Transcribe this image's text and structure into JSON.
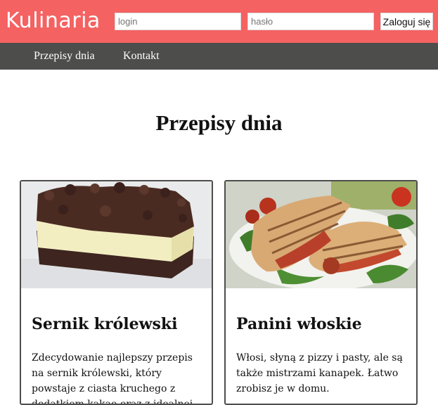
{
  "header": {
    "logo": "Kulinaria",
    "login_placeholder": "login",
    "password_placeholder": "hasło",
    "login_button": "Zaloguj się"
  },
  "nav": {
    "items": [
      "Przepisy dnia",
      "Kontakt"
    ]
  },
  "main": {
    "title": "Przepisy dnia",
    "recipes": [
      {
        "title": "Sernik królewski",
        "description": "Zdecydowanie najlepszy przepis na sernik królewski, który powstaje z ciasta kruchego z dodatkiem kakao oraz z idealnej"
      },
      {
        "title": "Panini włoskie",
        "description": "Włosi, słyną z pizzy i pasty, ale są także mistrzami kanapek. Łatwo zrobisz je w domu."
      }
    ]
  },
  "colors": {
    "header_bg": "#f46262",
    "nav_bg": "#4d4d4b"
  }
}
